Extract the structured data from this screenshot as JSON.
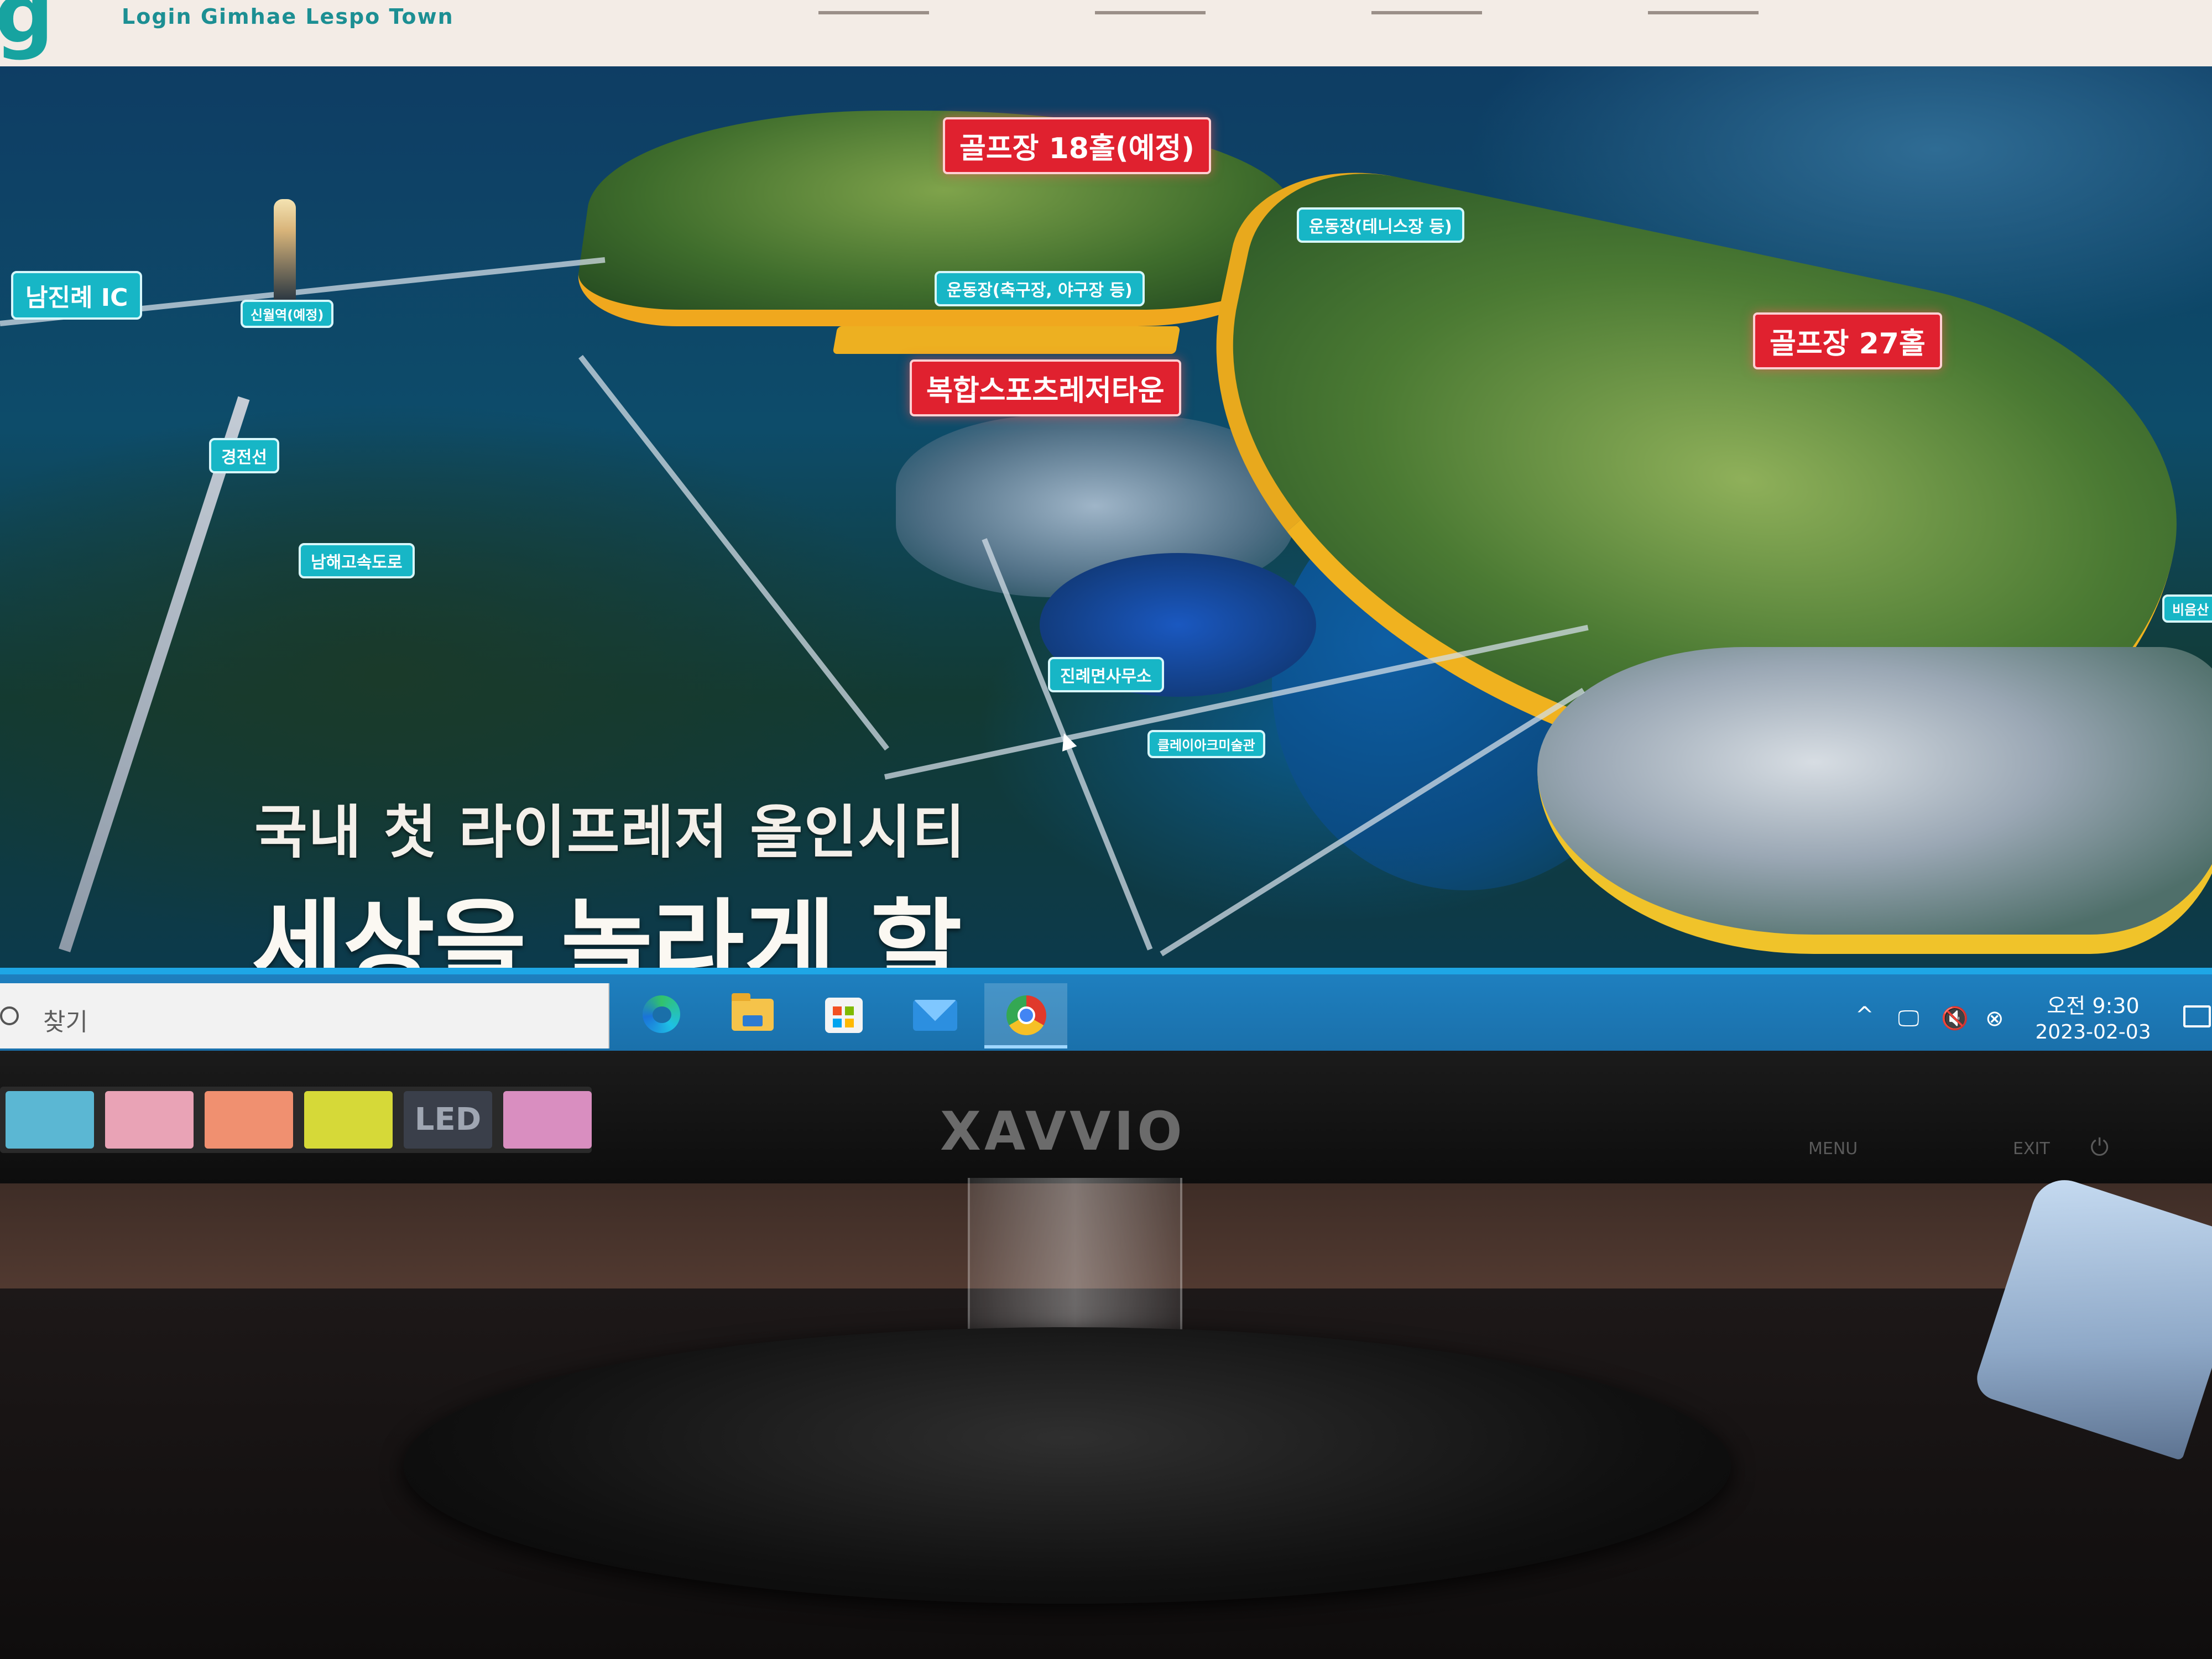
{
  "website": {
    "logo_text": "g",
    "logo_subtitle": "Login Gimhae Lespo Town"
  },
  "map": {
    "labels": {
      "golf_18": "골프장 18홀(예정)",
      "golf_27": "골프장 27홀",
      "sports_complex": "복합스포츠레저타운",
      "sports_tennis": "운동장(테니스장 등)",
      "sports_football": "운동장(축구장, 야구장 등)",
      "namjinrye_ic": "남진례 IC",
      "station": "신월역(예정)",
      "line": "경전선",
      "expressway": "남해고속도로",
      "office": "진례면사무소",
      "museum": "클레이아크미술관",
      "edge_label": "비음산"
    },
    "headline_line1": "국내 첫 라이프레저 올인시티",
    "headline_line2": "세상을 놀라게 할"
  },
  "taskbar": {
    "search_placeholder": "찾기",
    "apps": [
      {
        "name": "edge-icon"
      },
      {
        "name": "file-explorer-icon"
      },
      {
        "name": "microsoft-store-icon"
      },
      {
        "name": "mail-icon"
      },
      {
        "name": "chrome-icon"
      }
    ],
    "tray": {
      "chevron": "^",
      "time": "오전 9:30",
      "date": "2023-02-03"
    }
  },
  "monitor": {
    "brand": "XAVVIO",
    "buttons": {
      "menu": "MENU",
      "exit": "EXIT",
      "power": "⏻"
    },
    "sticker_text": "LED"
  }
}
